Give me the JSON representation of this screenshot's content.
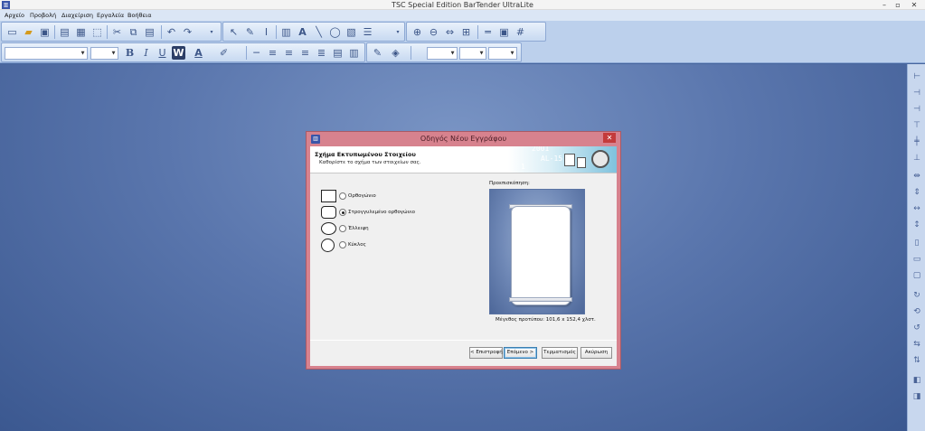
{
  "window": {
    "title": "TSC Special Edition BarTender UltraLite",
    "icon": "bartender-app-icon",
    "minimize_glyph": "–",
    "restore_glyph": "▫",
    "close_glyph": "✕"
  },
  "menu": {
    "items": [
      "Αρχείο",
      "Προβολή",
      "Διαχείριση",
      "Εργαλεία",
      "Βοήθεια"
    ]
  },
  "format_toolbar": {
    "bold": "B",
    "italic": "I",
    "underline": "U",
    "wordart": "W",
    "font_color": "A"
  },
  "dialog": {
    "title": "Οδηγός Νέου Εγγράφου",
    "close_glyph": "✕",
    "header_title": "Σχήμα Εκτυπωμένου Στοιχείου",
    "header_subtitle": "Καθορίστε το σχήμα των στοιχείων σας.",
    "header_graphic_numbers": [
      "2001",
      "AL-15",
      "1"
    ],
    "shapes": [
      {
        "label": "Ορθογώνιο",
        "selected": false,
        "icon": "rectangle-icon"
      },
      {
        "label": "Στρογγυλεμένο ορθογώνιο",
        "selected": true,
        "icon": "rounded-rectangle-icon"
      },
      {
        "label": "Έλλειψη",
        "selected": false,
        "icon": "ellipse-icon"
      },
      {
        "label": "Κύκλος",
        "selected": false,
        "icon": "circle-icon"
      }
    ],
    "preview_label": "Προεπισκόπηση:",
    "paper_size": "Μέγεθος προτύπου:  101,6 x 152,4 χλστ.",
    "buttons": {
      "back": "< Επιστροφή",
      "next": "Επόμενο >",
      "finish": "Τερματισμός",
      "cancel": "Ακύρωση"
    }
  },
  "colors": {
    "workspace": "#5a76ad",
    "dialog_frame": "#d7828e",
    "accent": "#3a55a8"
  }
}
